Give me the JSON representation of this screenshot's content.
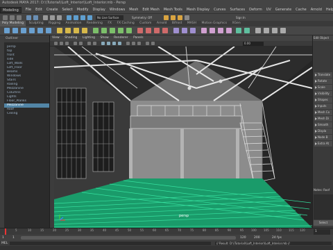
{
  "app": {
    "title": "Autodesk MAYA 2017: D:\\\\Tutorial\\\\Loft_Interior\\\\Loft_Interior.mb - Persp"
  },
  "menubar": {
    "mode": "Modeling",
    "items": [
      "File",
      "Edit",
      "Create",
      "Select",
      "Modify",
      "Display",
      "Windows",
      "Mesh",
      "Edit Mesh",
      "Mesh Tools",
      "Mesh Display",
      "Curves",
      "Surfaces",
      "Deform",
      "UV",
      "Generate",
      "Cache",
      "Arnold",
      "Help"
    ],
    "no_live_surface": "No Live Surface",
    "symmetry": "Symmetry: Off",
    "sign_in": "Sign In"
  },
  "shelf": {
    "tabs": [
      "Poly Modeling",
      "Sculpting",
      "Rigging",
      "Animation",
      "Rendering",
      "FX",
      "FX Caching",
      "Custom",
      "Arnold",
      "Bifrost",
      "MASH",
      "Motion Graphics",
      "XGen"
    ],
    "active_tab": "Poly Modeling"
  },
  "outliner": {
    "header": "Outliner",
    "rows": [
      "persp",
      "top",
      "front",
      "side",
      "Loft_Walls",
      "Loft_Floor",
      "Beams",
      "Windows",
      "Stairs",
      "Railing",
      "Mezzanine",
      "Columns",
      "Lights",
      "Floor_Planks",
      "Roof",
      "Ceiling"
    ],
    "selected": "Mezzanine"
  },
  "viewport": {
    "menu": [
      "View",
      "Shading",
      "Lighting",
      "Show",
      "Renderer",
      "Panels"
    ],
    "field_value": "0.00",
    "camera_label": "persp",
    "colors": {
      "bg": "#5c5c5c",
      "floor": "#1a9b6a",
      "floor_line": "#36e2a0",
      "wall": "#9a9a9a",
      "dark": "#1e1e1e"
    }
  },
  "rightpanel": {
    "tabs": "Edit Object",
    "items": [
      "Translate",
      "Rotate",
      "Scale",
      "Visibility",
      "Shapes",
      "Inputs",
      "Mesh Co",
      "Mesh Di",
      "Smooth",
      "Displa",
      "Node B",
      "Extra At"
    ],
    "notes_label": "Notes: Roof",
    "select_button": "Select"
  },
  "timeslider": {
    "start": "1",
    "ticks": [
      "5",
      "10",
      "15",
      "20",
      "25",
      "30",
      "35",
      "40",
      "45",
      "50",
      "55",
      "60",
      "65",
      "70",
      "75",
      "80",
      "85",
      "90",
      "95",
      "100",
      "105",
      "110",
      "115",
      "120"
    ],
    "current": "1"
  },
  "rangeslider": {
    "start": "1",
    "range_start": "1",
    "range_end": "120",
    "end": "200",
    "fps": "24 fps"
  },
  "cmdline": {
    "label": "MEL",
    "result": "// Result: D:\\\\Tutorial\\\\Loft_Interior\\\\Loft_Interior.mb //"
  }
}
